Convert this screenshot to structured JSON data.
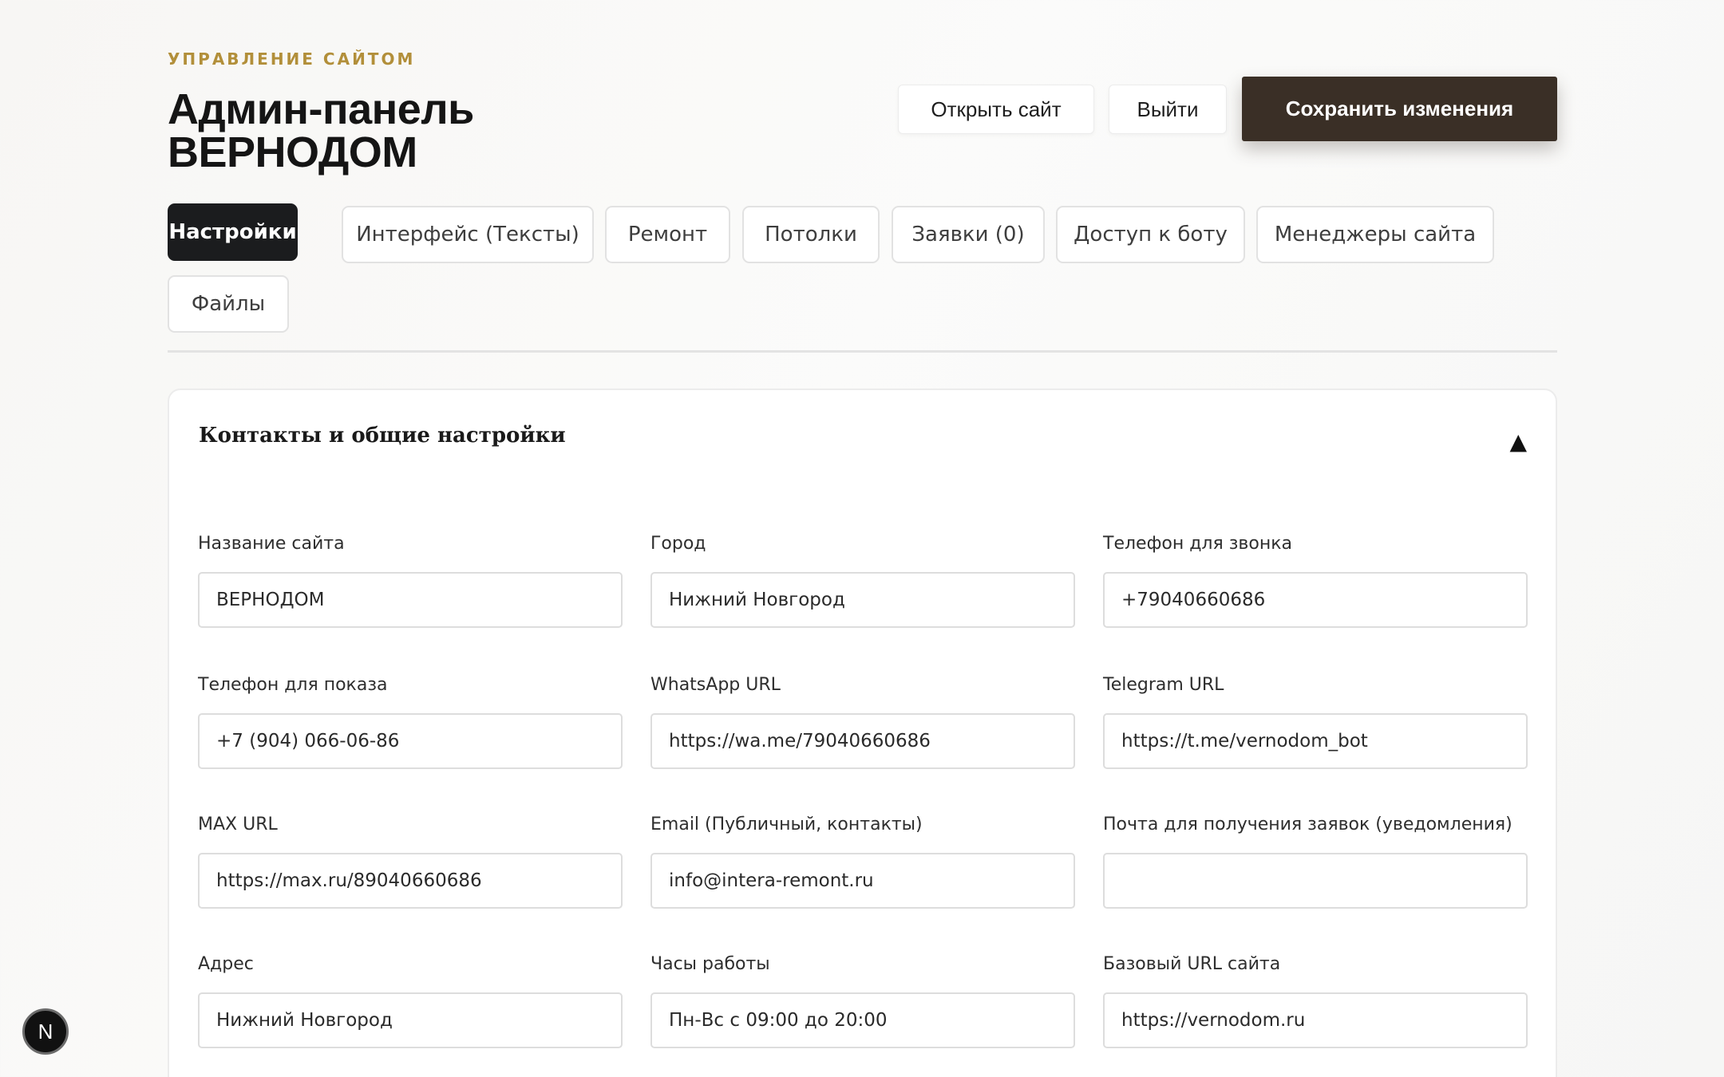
{
  "header": {
    "eyebrow": "УПРАВЛЕНИЕ САЙТОМ",
    "title": "Админ-панель ВЕРНОДОМ",
    "open_site_label": "Открыть сайт",
    "logout_label": "Выйти",
    "save_label": "Сохранить изменения"
  },
  "tabs": [
    {
      "label": "Настройки",
      "active": true
    },
    {
      "label": "Интерфейс (Тексты)",
      "active": false
    },
    {
      "label": "Ремонт",
      "active": false
    },
    {
      "label": "Потолки",
      "active": false
    },
    {
      "label": "Заявки (0)",
      "active": false
    },
    {
      "label": "Доступ к боту",
      "active": false
    },
    {
      "label": "Менеджеры сайта",
      "active": false
    },
    {
      "label": "Файлы",
      "active": false
    }
  ],
  "section": {
    "title": "Контакты и общие настройки",
    "collapse_icon": "▲",
    "fields": [
      {
        "label": "Название сайта",
        "value": "ВЕРНОДОМ"
      },
      {
        "label": "Город",
        "value": "Нижний Новгород"
      },
      {
        "label": "Телефон для звонка",
        "value": "+79040660686"
      },
      {
        "label": "Телефон для показа",
        "value": "+7 (904) 066-06-86"
      },
      {
        "label": "WhatsApp URL",
        "value": "https://wa.me/79040660686"
      },
      {
        "label": "Telegram URL",
        "value": "https://t.me/vernodom_bot"
      },
      {
        "label": "MAX URL",
        "value": "https://max.ru/89040660686"
      },
      {
        "label": "Email (Публичный, контакты)",
        "value": "info@intera-remont.ru"
      },
      {
        "label": "Почта для получения заявок (уведомления)",
        "value": ""
      },
      {
        "label": "Адрес",
        "value": "Нижний Новгород"
      },
      {
        "label": "Часы работы",
        "value": "Пн-Вс с 09:00 до 20:00"
      },
      {
        "label": "Базовый URL сайта",
        "value": "https://vernodom.ru"
      }
    ]
  },
  "badge": {
    "letter": "N"
  }
}
